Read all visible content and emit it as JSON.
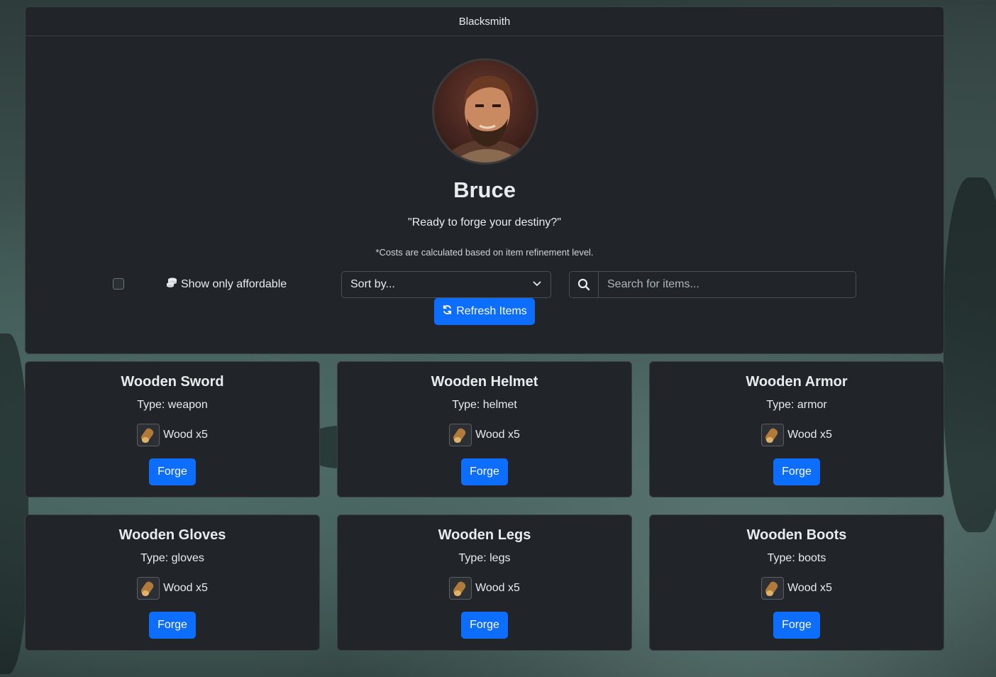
{
  "window": {
    "title": "Blacksmith"
  },
  "npc": {
    "name": "Bruce",
    "quote": "\"Ready to forge your destiny?\"",
    "cost_note": "*Costs are calculated based on item refinement level."
  },
  "filters": {
    "affordable_label": "Show only affordable",
    "affordable_checked": false,
    "sort_label": "Sort by...",
    "search_placeholder": "Search for items...",
    "refresh_label": "Refresh Items"
  },
  "items": [
    {
      "name": "Wooden Sword",
      "type": "Type: weapon",
      "cost": "Wood x5",
      "action": "Forge"
    },
    {
      "name": "Wooden Helmet",
      "type": "Type: helmet",
      "cost": "Wood x5",
      "action": "Forge"
    },
    {
      "name": "Wooden Armor",
      "type": "Type: armor",
      "cost": "Wood x5",
      "action": "Forge"
    },
    {
      "name": "Wooden Gloves",
      "type": "Type: gloves",
      "cost": "Wood x5",
      "action": "Forge"
    },
    {
      "name": "Wooden Legs",
      "type": "Type: legs",
      "cost": "Wood x5",
      "action": "Forge"
    },
    {
      "name": "Wooden Boots",
      "type": "Type: boots",
      "cost": "Wood x5",
      "action": "Forge"
    }
  ],
  "colors": {
    "primary": "#0d6efd",
    "panel": "#212529",
    "border": "#3a3f44"
  }
}
